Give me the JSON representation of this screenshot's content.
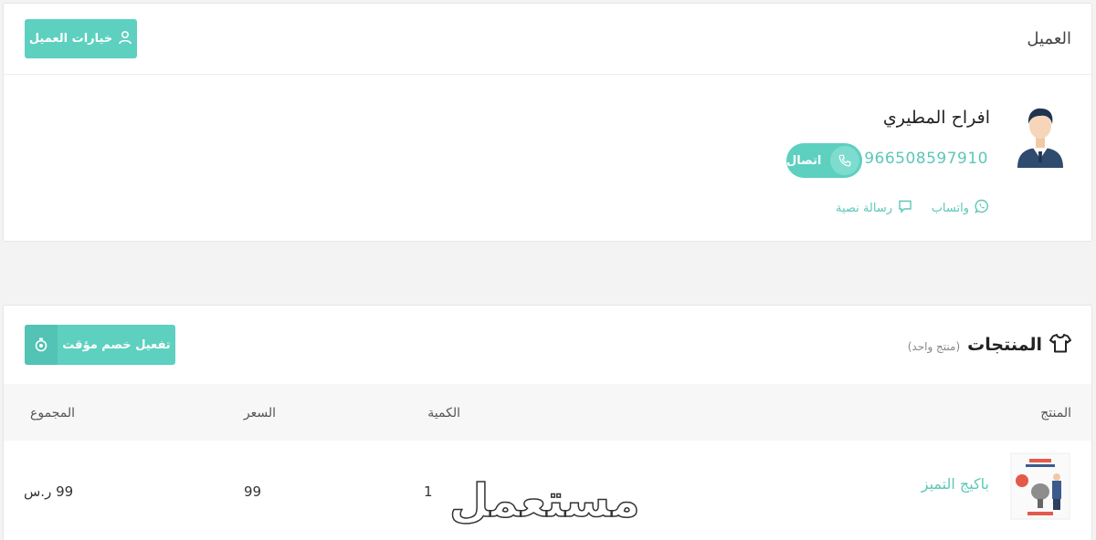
{
  "customer": {
    "section_title": "العميل",
    "options_button": "خيارات العميل",
    "name": "افراح المطيري",
    "phone": "+966508597910",
    "call_button": "اتصال",
    "whatsapp_link": "واتساب",
    "sms_link": "رسالة نصية"
  },
  "products": {
    "section_title": "المنتجات",
    "count_label": "(منتج واحد)",
    "discount_button": "تفعيل خصم مؤقت",
    "columns": {
      "product": "المنتج",
      "quantity": "الكمية",
      "price": "السعر",
      "total": "المجموع"
    },
    "rows": [
      {
        "name": "باكيج التميز",
        "quantity": "1",
        "price": "99",
        "total": "99 ر.س"
      }
    ]
  },
  "watermark": "مستعمل",
  "colors": {
    "accent": "#5dd0c0",
    "link": "#5dc7b8"
  },
  "icons": [
    "user-icon",
    "phone-icon",
    "whatsapp-icon",
    "message-icon",
    "tshirt-icon",
    "stopwatch-icon"
  ]
}
